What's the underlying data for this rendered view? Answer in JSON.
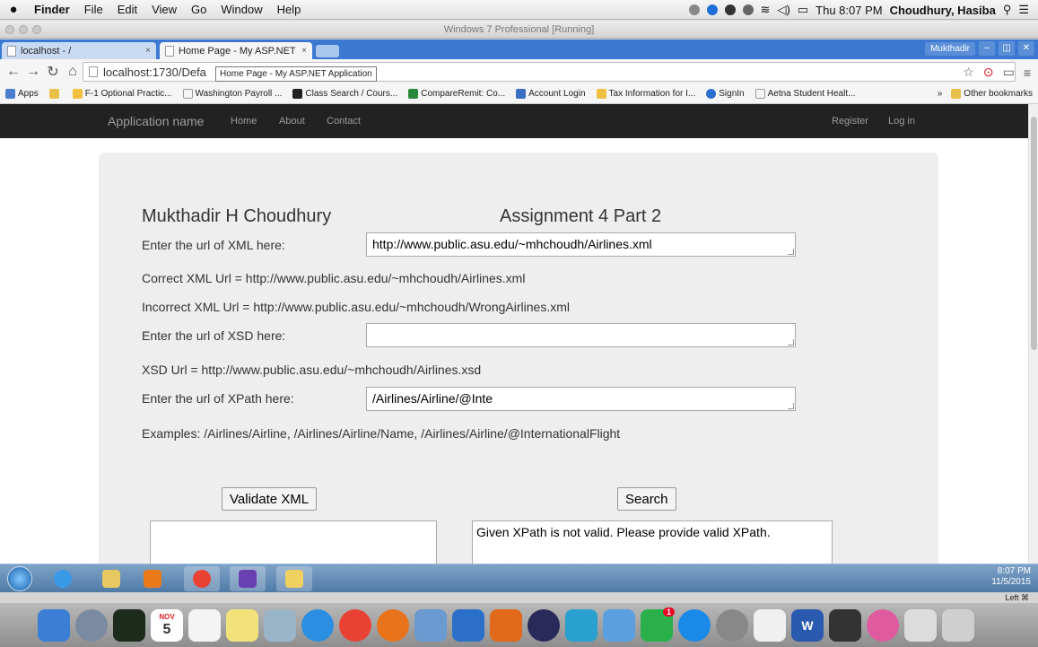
{
  "mac_menubar": {
    "menus": [
      "Finder",
      "File",
      "Edit",
      "View",
      "Go",
      "Window",
      "Help"
    ],
    "clock": "Thu 8:07 PM",
    "user": "Choudhury, Hasiba"
  },
  "vm": {
    "title": "Windows 7 Professional [Running]",
    "status": "Left ⌘"
  },
  "browser": {
    "tabs": [
      {
        "label": "localhost - /"
      },
      {
        "label": "Home Page - My ASP.NET"
      }
    ],
    "window_user": "Mukthadir",
    "address": "localhost:1730/Defa",
    "tooltip": "Home Page - My ASP.NET Application",
    "bookmarks": [
      "Apps",
      "F-1 Optional Practic...",
      "Washington Payroll ...",
      "Class Search / Cours...",
      "CompareRemit: Co...",
      "Account Login",
      "Tax Information for I...",
      "SignIn",
      "Aetna Student Healt..."
    ],
    "other_bookmarks": "Other bookmarks",
    "overflow": "»"
  },
  "site": {
    "brand": "Application name",
    "nav": [
      "Home",
      "About",
      "Contact"
    ],
    "register": "Register",
    "login": "Log in"
  },
  "form": {
    "name": "Mukthadir H Choudhury",
    "assignment": "Assignment 4 Part 2",
    "xml_label": "Enter the url of XML here:",
    "xml_value": "http://www.public.asu.edu/~mhchoudh/Airlines.xml",
    "correct_xml": "Correct XML Url = http://www.public.asu.edu/~mhchoudh/Airlines.xml",
    "incorrect_xml": "Incorrect XML Url = http://www.public.asu.edu/~mhchoudh/WrongAirlines.xml",
    "xsd_label": "Enter the url of XSD here:",
    "xsd_value": "",
    "xsd_url": "XSD Url = http://www.public.asu.edu/~mhchoudh/Airlines.xsd",
    "xpath_label": "Enter the url of XPath here:",
    "xpath_value": "/Airlines/Airline/@Inte",
    "examples": "Examples: /Airlines/Airline, /Airlines/Airline/Name, /Airlines/Airline/@InternationalFlight",
    "validate_button": "Validate XML",
    "search_button": "Search",
    "validate_output": "",
    "search_output": "Given XPath is not valid. Please provide valid XPath."
  },
  "taskbar": {
    "time": "8:07 PM",
    "date": "11/5/2015"
  },
  "dock": {
    "calendar_month": "NOV",
    "calendar_day": "5",
    "badge": "1"
  }
}
